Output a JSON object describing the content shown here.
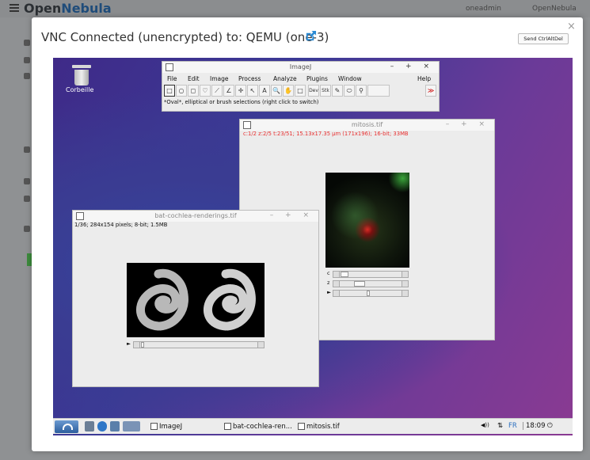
{
  "background_app": {
    "logo_prefix": "Open",
    "logo_suffix": "Nebula",
    "user": "oneadmin",
    "zone": "OpenNebula"
  },
  "modal": {
    "title": "VNC Connected (unencrypted) to: QEMU (one-3)",
    "close_label": "×",
    "send_button": "Send CtrlAltDel"
  },
  "desktop": {
    "trash_label": "Corbeille"
  },
  "imagej": {
    "title": "ImageJ",
    "controls": "– + ×",
    "menu": [
      "File",
      "Edit",
      "Image",
      "Process",
      "Analyze",
      "Plugins",
      "Window",
      "Help"
    ],
    "tools": [
      "□",
      "○",
      "◻",
      "♡",
      "⟋",
      "∠",
      "✛",
      "↖",
      "A",
      "🔍",
      "✋",
      "□",
      "Dev",
      "Stk",
      "✎",
      "⬭",
      "⚲",
      "",
      "≫"
    ],
    "status": "*Oval*, elliptical or brush selections (right click to switch)"
  },
  "mitosis": {
    "title": "mitosis.tif",
    "controls": "– + ×",
    "info": "c:1/2 z:2/5 t:23/51; 15.13x17.35 µm (171x196); 16-bit; 33MB",
    "slider_c": "c",
    "slider_z": "z",
    "slider_t": "►"
  },
  "cochlea": {
    "title": "bat-cochlea-renderings.tif",
    "controls": "– + ×",
    "info": "1/36; 284x154 pixels; 8-bit; 1.5MB",
    "slider_play": "►"
  },
  "taskbar": {
    "tasks": [
      "ImageJ",
      "bat-cochlea-ren...",
      "mitosis.tif"
    ],
    "volume": "◀))",
    "network": "⇅",
    "lang": "FR",
    "time": "18:09",
    "power": "⏻"
  },
  "colors": {
    "desktop_top": "#3b3a96",
    "desktop_right": "#8a3a92",
    "info_red": "#e83030",
    "link_blue": "#2a8ad4"
  }
}
